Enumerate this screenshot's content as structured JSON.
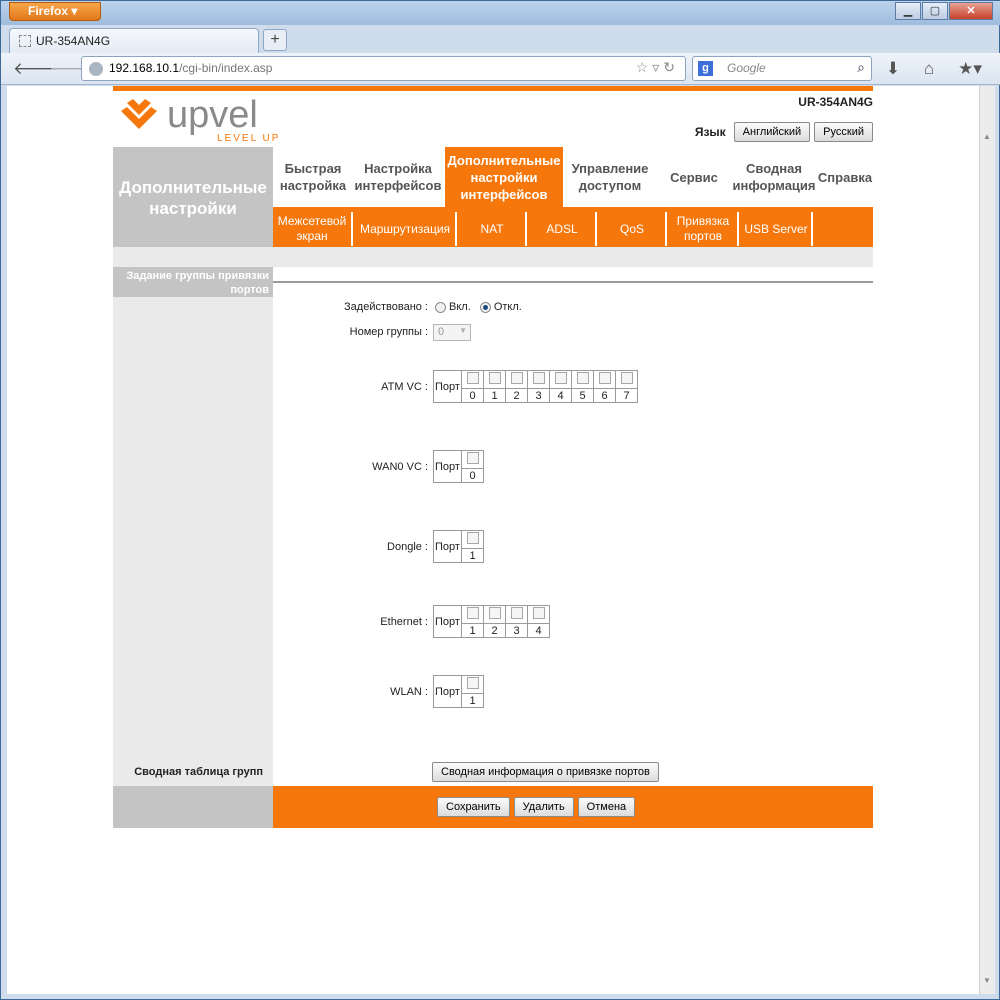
{
  "browser": {
    "menu_label": "Firefox",
    "tab_title": "UR-354AN4G",
    "url_host": "192.168.10.1",
    "url_path": "/cgi-bin/index.asp",
    "search_placeholder": "Google"
  },
  "header": {
    "logo_text": "upvel",
    "logo_tagline": "LEVEL UP",
    "model": "UR-354AN4G",
    "language_label": "Язык",
    "lang_en": "Английский",
    "lang_ru": "Русский",
    "brand_color": "#f6780c"
  },
  "menu": {
    "section_title": "Дополнительные настройки",
    "top": [
      {
        "label": "Быстрая настройка"
      },
      {
        "label": "Настройка интерфейсов"
      },
      {
        "label": "Дополнительные настройки интерфейсов"
      },
      {
        "label": "Управление доступом"
      },
      {
        "label": "Сервис"
      },
      {
        "label": "Сводная информация"
      },
      {
        "label": "Справка"
      }
    ],
    "sub": [
      {
        "label": "Межсетевой экран"
      },
      {
        "label": "Маршрутизация"
      },
      {
        "label": "NAT"
      },
      {
        "label": "ADSL"
      },
      {
        "label": "QoS"
      },
      {
        "label": "Привязка портов"
      },
      {
        "label": "USB Server"
      }
    ]
  },
  "sidebar": {
    "title": "Задание группы привязки портов"
  },
  "form": {
    "enabled_label": "Задействовано :",
    "on_label": "Вкл.",
    "off_label": "Откл.",
    "group_label": "Номер группы :",
    "group_value": "0",
    "port_head": "Порт",
    "atm": {
      "label": "ATM VC :",
      "ports": [
        "0",
        "1",
        "2",
        "3",
        "4",
        "5",
        "6",
        "7"
      ]
    },
    "wan": {
      "label": "WAN0 VC :",
      "ports": [
        "0"
      ]
    },
    "dongle": {
      "label": "Dongle :",
      "ports": [
        "1"
      ]
    },
    "ethernet": {
      "label": "Ethernet :",
      "ports": [
        "1",
        "2",
        "3",
        "4"
      ]
    },
    "wlan": {
      "label": "WLAN :",
      "ports": [
        "1"
      ]
    }
  },
  "summary": {
    "label": "Сводная таблица групп",
    "button": "Сводная информация о привязке портов"
  },
  "footer": {
    "save": "Сохранить",
    "delete": "Удалить",
    "cancel": "Отмена"
  }
}
